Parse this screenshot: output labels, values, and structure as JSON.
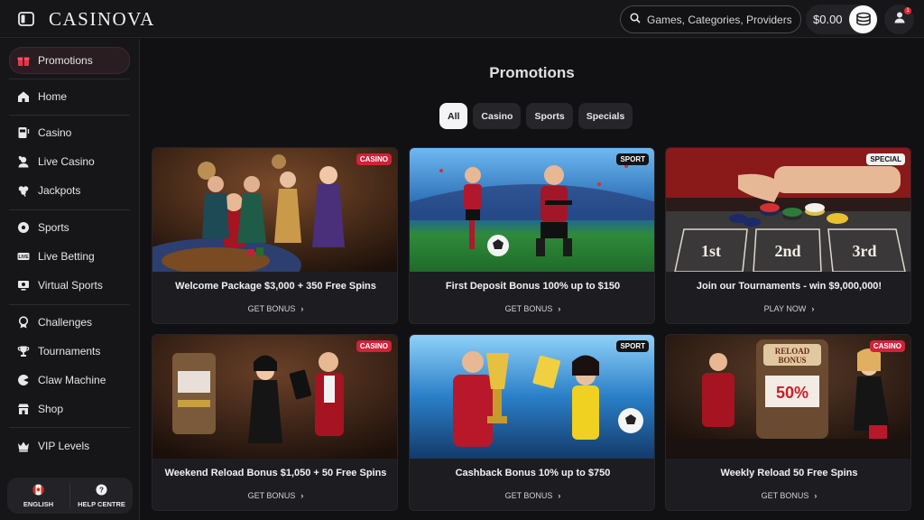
{
  "header": {
    "logo": "CASINOVA",
    "search_placeholder": "Games, Categories, Providers",
    "balance": "$0.00",
    "notification_count": "1"
  },
  "sidebar": {
    "items": [
      {
        "label": "Promotions",
        "icon": "gift-icon"
      },
      {
        "label": "Home",
        "icon": "home-icon"
      },
      {
        "label": "Casino",
        "icon": "slot-machine-icon"
      },
      {
        "label": "Live Casino",
        "icon": "dealer-icon"
      },
      {
        "label": "Jackpots",
        "icon": "clover-icon"
      },
      {
        "label": "Sports",
        "icon": "soccer-ball-icon"
      },
      {
        "label": "Live Betting",
        "icon": "live-icon"
      },
      {
        "label": "Virtual Sports",
        "icon": "monitor-icon"
      },
      {
        "label": "Challenges",
        "icon": "medal-icon"
      },
      {
        "label": "Tournaments",
        "icon": "trophy-icon"
      },
      {
        "label": "Claw Machine",
        "icon": "claw-icon"
      },
      {
        "label": "Shop",
        "icon": "shop-icon"
      },
      {
        "label": "VIP Levels",
        "icon": "crown-icon"
      }
    ],
    "language": "ENGLISH",
    "help": "HELP CENTRE"
  },
  "main": {
    "title": "Promotions",
    "filters": [
      "All",
      "Casino",
      "Sports",
      "Specials"
    ],
    "active_filter": "All",
    "cards": [
      {
        "badge": "CASINO",
        "title": "Welcome Package $3,000 + 350 Free Spins",
        "cta": "GET BONUS"
      },
      {
        "badge": "SPORT",
        "title": "First Deposit Bonus 100% up to $150",
        "cta": "GET BONUS"
      },
      {
        "badge": "SPECIAL",
        "title": "Join our Tournaments - win $9,000,000!",
        "cta": "PLAY NOW"
      },
      {
        "badge": "CASINO",
        "title": "Weekend Reload Bonus $1,050 + 50 Free Spins",
        "cta": "GET BONUS"
      },
      {
        "badge": "SPORT",
        "title": "Cashback Bonus 10% up to $750",
        "cta": "GET BONUS"
      },
      {
        "badge": "CASINO",
        "title": "Weekly Reload 50 Free Spins",
        "cta": "GET BONUS"
      }
    ],
    "tournament_image_labels": [
      "1st",
      "2nd",
      "3rd"
    ],
    "reload_image_labels": [
      "RELOAD",
      "BONUS",
      "50%"
    ]
  },
  "colors": {
    "background": "#111113",
    "casino_badge": "#d0223a",
    "active_nav": "#2a1d21"
  }
}
